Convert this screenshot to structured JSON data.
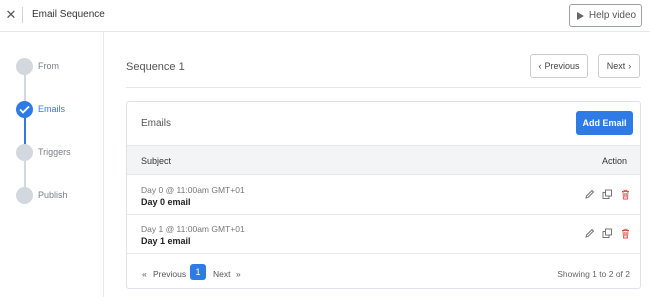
{
  "window": {
    "title": "Email Sequence",
    "help_label": "Help video"
  },
  "steps": [
    {
      "label": "From",
      "state": "done"
    },
    {
      "label": "Emails",
      "state": "active"
    },
    {
      "label": "Triggers",
      "state": "pending"
    },
    {
      "label": "Publish",
      "state": "pending"
    }
  ],
  "main": {
    "sequence_title": "Sequence 1",
    "prev_label": "Previous",
    "next_label": "Next"
  },
  "card": {
    "title": "Emails",
    "add_label": "Add Email",
    "columns": {
      "subject": "Subject",
      "action": "Action"
    },
    "rows": [
      {
        "meta": "Day 0 @ 11:00am GMT+01",
        "subject": "Day 0 email"
      },
      {
        "meta": "Day 1 @ 11:00am GMT+01",
        "subject": "Day 1 email"
      }
    ],
    "actions": [
      "edit-icon",
      "duplicate-icon",
      "delete-icon"
    ]
  },
  "pagination": {
    "first": "«",
    "prev": "Previous",
    "current": "1",
    "next": "Next",
    "last": "»",
    "summary": "Showing 1 to 2 of 2"
  },
  "colors": {
    "accent": "#2e7be5",
    "danger": "#d9534f",
    "muted": "#d3d8de"
  }
}
